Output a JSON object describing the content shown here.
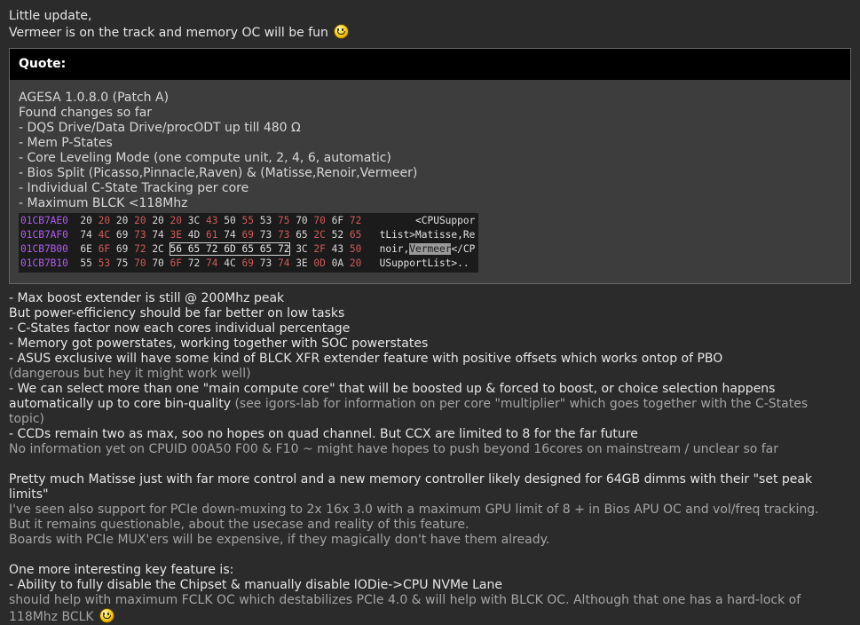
{
  "intro": [
    "Little update,",
    "Vermeer is on the track and memory OC will be fun"
  ],
  "quote": {
    "header": "Quote:",
    "lines": [
      "AGESA 1.0.8.0 (Patch A)",
      "Found changes so far",
      "- DQS Drive/Data Drive/procODT up till 480 Ω",
      "- Mem P-States",
      "- Core Leveling Mode (one compute unit, 2, 4, 6, automatic)",
      "- Bios Split (Picasso,Pinnacle,Raven) & (Matisse,Renoir,Vermeer)",
      "- Individual C-State Tracking per core",
      "- Maximum BLCK <118Mhz"
    ],
    "hex": [
      {
        "addr": "01CB7AE0",
        "bytes": [
          "20",
          "20",
          "20",
          "20",
          "20",
          "20",
          "3C",
          "43",
          "50",
          "55",
          "53",
          "75",
          "70",
          "70",
          "6F",
          "72"
        ],
        "ascii": "      <CPUSuppor"
      },
      {
        "addr": "01CB7AF0",
        "bytes": [
          "74",
          "4C",
          "69",
          "73",
          "74",
          "3E",
          "4D",
          "61",
          "74",
          "69",
          "73",
          "73",
          "65",
          "2C",
          "52",
          "65"
        ],
        "ascii": "tList>Matisse,Re"
      },
      {
        "addr": "01CB7B00",
        "bytes": [
          "6E",
          "6F",
          "69",
          "72",
          "2C",
          "56",
          "65",
          "72",
          "6D",
          "65",
          "65",
          "72",
          "3C",
          "2F",
          "43",
          "50"
        ],
        "ascii": "noir,Vermeer</CP"
      },
      {
        "addr": "01CB7B10",
        "bytes": [
          "55",
          "53",
          "75",
          "70",
          "70",
          "6F",
          "72",
          "74",
          "4C",
          "69",
          "73",
          "74",
          "3E",
          "0D",
          "0A",
          "20"
        ],
        "ascii": "USupportList>.. "
      }
    ]
  },
  "body": {
    "l1": "- Max boost extender is still @ 200Mhz peak",
    "l2": "But power-efficiency should be far better on low tasks",
    "l3": "- C-States factor now each cores individual percentage",
    "l4": "- Memory got powerstates, working together with SOC powerstates",
    "l5": "- ASUS exclusive will have some kind of BLCK XFR extender feature with positive offsets which works ontop of PBO",
    "l6": "(dangerous but hey it might work well)",
    "l7a": "- We can select more than one \"main compute core\" that will be boosted up & forced to boost, or choice selection happens",
    "l7b": "automatically up to core bin-quality",
    "l7c": "(see igors-lab for information on per core \"multiplier\" which goes together with the C-States",
    "l8": "topic)",
    "l9": "- CCDs remain two as max, soo no hopes on quad channel. But CCX are limited to 8 for the far future",
    "l10": "No information yet on CPUID 00A50 F00 & F10 ~ might have hopes to push beyond 16cores on mainstream / unclear so far",
    "p2a": "Pretty much Matisse just with far more control and a new memory controller likely designed for 64GB dimms with their \"set peak",
    "p2b": "limits\"",
    "p2c": "I've seen also support for PCIe down-muxing to 2x 16x 3.0 with a maximum GPU limit of 8 + in Bios APU OC and vol/freq tracking.",
    "p2d": "But it remains questionable, about the usecase and reality of this feature.",
    "p2e": "Boards with PCIe MUX'ers will be expensive, if they magically don't have them already.",
    "p3a": "One more interesting key feature is:",
    "p3b": "- Ability to fully disable the Chipset & manually disable IODie->CPU NVMe Lane",
    "p3c": "should help with maximum FCLK OC which destabilizes PCIe 4.0 & will help with BLCK OC. Although that one has a hard-lock of",
    "p3d": "118Mhz BCLK"
  }
}
